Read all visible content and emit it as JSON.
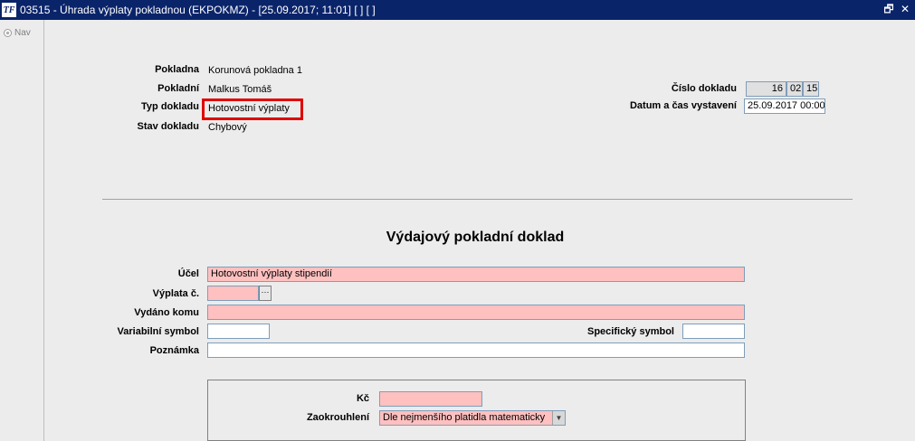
{
  "window": {
    "title": "03515 - Úhrada výplaty pokladnou (EKPOKMZ) - [25.09.2017; 11:01] [ ] [ ]",
    "logo": "TF",
    "restore_icon": "🗗",
    "close_icon": "✕"
  },
  "nav": {
    "label": "Nav"
  },
  "header": {
    "pokladna_label": "Pokladna",
    "pokladna_value": "Korunová pokladna 1",
    "pokladni_label": "Pokladní",
    "pokladni_value": "Malkus Tomáš",
    "typ_label": "Typ dokladu",
    "typ_value": "Hotovostní výplaty",
    "stav_label": "Stav dokladu",
    "stav_value": "Chybový",
    "cislo_label": "Číslo dokladu",
    "cislo_part1": "16",
    "cislo_part2": "02",
    "cislo_part3": "15",
    "datum_label": "Datum a čas vystavení",
    "datum_value": "25.09.2017 00:00"
  },
  "form": {
    "title": "Výdajový pokladní doklad",
    "ucel_label": "Účel",
    "ucel_value": "Hotovostní výplaty stipendií",
    "vyplata_label": "Výplata č.",
    "vyplata_value": "",
    "ellipsis": "···",
    "vydano_label": "Vydáno komu",
    "vydano_value": "",
    "variabilni_label": "Variabilní symbol",
    "variabilni_value": "",
    "specificky_label": "Specifický symbol",
    "specificky_value": "",
    "poznamka_label": "Poznámka",
    "poznamka_value": "",
    "kc_label": "Kč",
    "kc_value": "",
    "zaokrouhleni_label": "Zaokrouhlení",
    "zaokrouhleni_value": "Dle nejmenšího platidla matematicky"
  },
  "colors": {
    "titlebar": "#0a246a",
    "required_field": "#ffc0c0",
    "highlight": "#e00000"
  }
}
